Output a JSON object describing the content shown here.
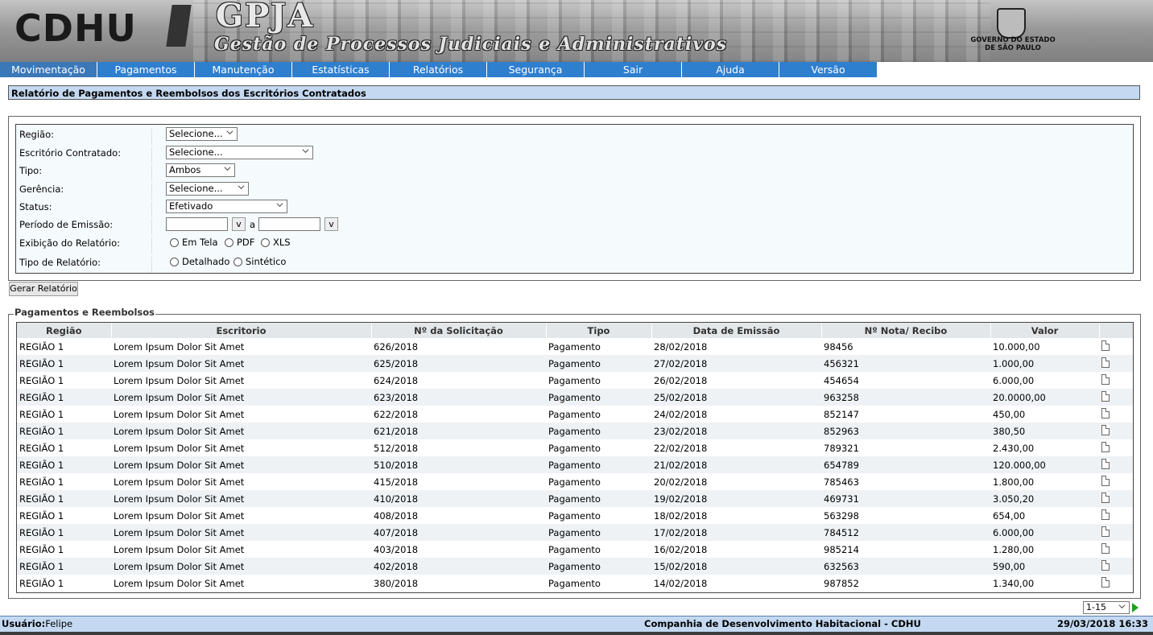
{
  "header": {
    "logo": "CDHU",
    "app_name": "GPJA",
    "app_subtitle": "Gestão de Processos Judiciais e Administrativos",
    "gov_line1": "GOVERNO DO ESTADO",
    "gov_line2": "DE SÃO PAULO"
  },
  "menu": [
    "Movimentação",
    "Pagamentos",
    "Manutenção",
    "Estatísticas",
    "Relatórios",
    "Segurança",
    "Sair",
    "Ajuda",
    "Versão"
  ],
  "page_title": "Relatório de Pagamentos e Reembolsos dos Escritórios Contratados",
  "filters": {
    "regiao": {
      "label": "Região:",
      "value": "Selecione..."
    },
    "escritorio": {
      "label": "Escritório Contratado:",
      "value": "Selecione..."
    },
    "tipo": {
      "label": "Tipo:",
      "value": "Ambos"
    },
    "gerencia": {
      "label": "Gerência:",
      "value": "Selecione..."
    },
    "status": {
      "label": "Status:",
      "value": "Efetivado"
    },
    "periodo": {
      "label": "Período de Emissão:",
      "btn": "v",
      "separator": "a"
    },
    "exibicao": {
      "label": "Exibição do Relatório:",
      "options": [
        "Em Tela",
        "PDF",
        "XLS"
      ]
    },
    "tipo_relatorio": {
      "label": "Tipo de Relatório:",
      "options": [
        "Detalhado",
        "Sintético"
      ]
    }
  },
  "generate_button": "Gerar Relatório",
  "results": {
    "legend": "Pagamentos e Reembolsos",
    "columns": [
      "Região",
      "Escritorio",
      "Nº da Solicitação",
      "Tipo",
      "Data de Emissão",
      "Nº Nota/ Recibo",
      "Valor"
    ],
    "rows": [
      [
        "REGIÃO 1",
        "Lorem Ipsum Dolor Sit Amet",
        "626/2018",
        "Pagamento",
        "28/02/2018",
        "98456",
        "10.000,00"
      ],
      [
        "REGIÃO 1",
        "Lorem Ipsum Dolor Sit Amet",
        "625/2018",
        "Pagamento",
        "27/02/2018",
        "456321",
        "1.000,00"
      ],
      [
        "REGIÃO 1",
        "Lorem Ipsum Dolor Sit Amet",
        "624/2018",
        "Pagamento",
        "26/02/2018",
        "454654",
        "6.000,00"
      ],
      [
        "REGIÃO 1",
        "Lorem Ipsum Dolor Sit Amet",
        "623/2018",
        "Pagamento",
        "25/02/2018",
        "963258",
        "20.0000,00"
      ],
      [
        "REGIÃO 1",
        "Lorem Ipsum Dolor Sit Amet",
        "622/2018",
        "Pagamento",
        "24/02/2018",
        "852147",
        "450,00"
      ],
      [
        "REGIÃO 1",
        "Lorem Ipsum Dolor Sit Amet",
        "621/2018",
        "Pagamento",
        "23/02/2018",
        "852963",
        "380,50"
      ],
      [
        "REGIÃO 1",
        "Lorem Ipsum Dolor Sit Amet",
        "512/2018",
        "Pagamento",
        "22/02/2018",
        "789321",
        "2.430,00"
      ],
      [
        "REGIÃO 1",
        "Lorem Ipsum Dolor Sit Amet",
        "510/2018",
        "Pagamento",
        "21/02/2018",
        "654789",
        "120.000,00"
      ],
      [
        "REGIÃO 1",
        "Lorem Ipsum Dolor Sit Amet",
        "415/2018",
        "Pagamento",
        "20/02/2018",
        "785463",
        "1.800,00"
      ],
      [
        "REGIÃO 1",
        "Lorem Ipsum Dolor Sit Amet",
        "410/2018",
        "Pagamento",
        "19/02/2018",
        "469731",
        "3.050,20"
      ],
      [
        "REGIÃO 1",
        "Lorem Ipsum Dolor Sit Amet",
        "408/2018",
        "Pagamento",
        "18/02/2018",
        "563298",
        "654,00"
      ],
      [
        "REGIÃO 1",
        "Lorem Ipsum Dolor Sit Amet",
        "407/2018",
        "Pagamento",
        "17/02/2018",
        "784512",
        "6.000,00"
      ],
      [
        "REGIÃO 1",
        "Lorem Ipsum Dolor Sit Amet",
        "403/2018",
        "Pagamento",
        "16/02/2018",
        "985214",
        "1.280,00"
      ],
      [
        "REGIÃO 1",
        "Lorem Ipsum Dolor Sit Amet",
        "402/2018",
        "Pagamento",
        "15/02/2018",
        "632563",
        "590,00"
      ],
      [
        "REGIÃO 1",
        "Lorem Ipsum Dolor Sit Amet",
        "380/2018",
        "Pagamento",
        "14/02/2018",
        "987852",
        "1.340,00"
      ]
    ]
  },
  "pagination": {
    "value": "1-15"
  },
  "status_bar": {
    "user_label": "Usuário:",
    "user_name": "Felipe",
    "company": "Companhia de Desenvolvimento Habitacional - CDHU",
    "datetime": "29/03/2018 16:33"
  }
}
